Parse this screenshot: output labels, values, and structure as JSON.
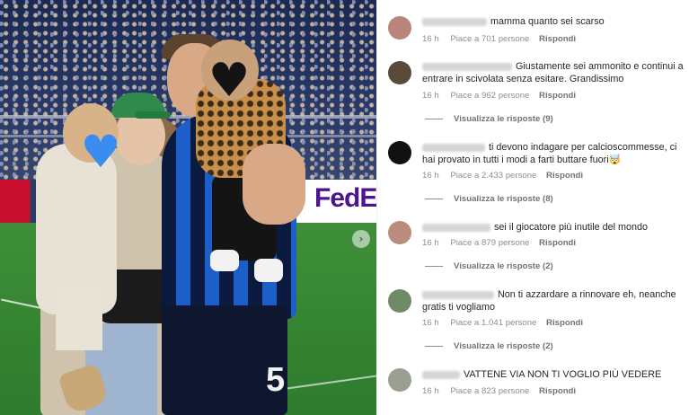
{
  "photo": {
    "sponsor_brand": "FedEx",
    "shirt_number": "5",
    "next_icon": "chevron-right-icon"
  },
  "comments": [
    {
      "avatar_color": "#b9857a",
      "text": "mamma quanto sei scarso",
      "time": "16 h",
      "likes": "Piace a 701 persone",
      "reply": "Rispondi",
      "view_replies": ""
    },
    {
      "avatar_color": "#5a4a3a",
      "text": "Giustamente sei ammonito e continui a entrare in scivolata senza esitare. Grandissimo",
      "time": "16 h",
      "likes": "Piace a 962 persone",
      "reply": "Rispondi",
      "view_replies": "Visualizza le risposte (9)"
    },
    {
      "avatar_color": "#111111",
      "text": "ti devono indagare per calcioscommesse, ci hai provato in tutti i modi a farti buttare fuori🤯",
      "time": "16 h",
      "likes": "Piace a 2.433 persone",
      "reply": "Rispondi",
      "view_replies": "Visualizza le risposte (8)"
    },
    {
      "avatar_color": "#b98c7e",
      "text": "sei il giocatore più inutile del mondo",
      "time": "16 h",
      "likes": "Piace a 879 persone",
      "reply": "Rispondi",
      "view_replies": "Visualizza le risposte (2)"
    },
    {
      "avatar_color": "#6f8a66",
      "text": "Non ti azzardare a rinnovare eh, neanche gratis ti vogliamo",
      "time": "16 h",
      "likes": "Piace a 1.041 persone",
      "reply": "Rispondi",
      "view_replies": "Visualizza le risposte (2)"
    },
    {
      "avatar_color": "#9aa08f",
      "text": "VATTENE VIA NON TI VOGLIO PIÙ VEDERE",
      "time": "16 h",
      "likes": "Piace a 823 persone",
      "reply": "Rispondi",
      "view_replies": ""
    }
  ]
}
